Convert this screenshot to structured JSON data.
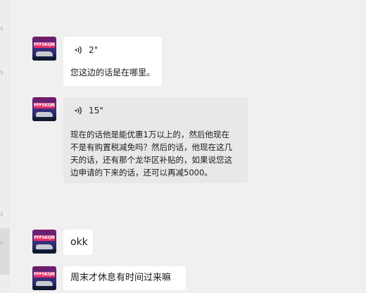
{
  "sidebar": {
    "marks": [
      "s",
      "s",
      "s",
      "s"
    ]
  },
  "messages": [
    {
      "sender_avatar_text": "FFFSKQREE",
      "voice_duration": "2\"",
      "transcript": "您这边的话是在哪里。"
    },
    {
      "sender_avatar_text": "FFFSKQREE",
      "voice_duration": "15\"",
      "transcript": "现在的话他是能优惠1万以上的，然后他现在\n不是有购置税减免吗？然后的话，他现在这几\n天的话，还有那个龙华区补贴的，如果说您这\n边申请的下来的话，还可以再减5000。"
    },
    {
      "sender_avatar_text": "FFFSKQREE",
      "text": "okk"
    },
    {
      "sender_avatar_text": "FFFSKQREE",
      "text": "周末才休息有时间过来嘛"
    }
  ],
  "colors": {
    "background": "#f0f0f0",
    "bubble_light": "#ffffff",
    "bubble_dark": "#e8e8e8"
  },
  "icons": [
    "voice-icon"
  ]
}
